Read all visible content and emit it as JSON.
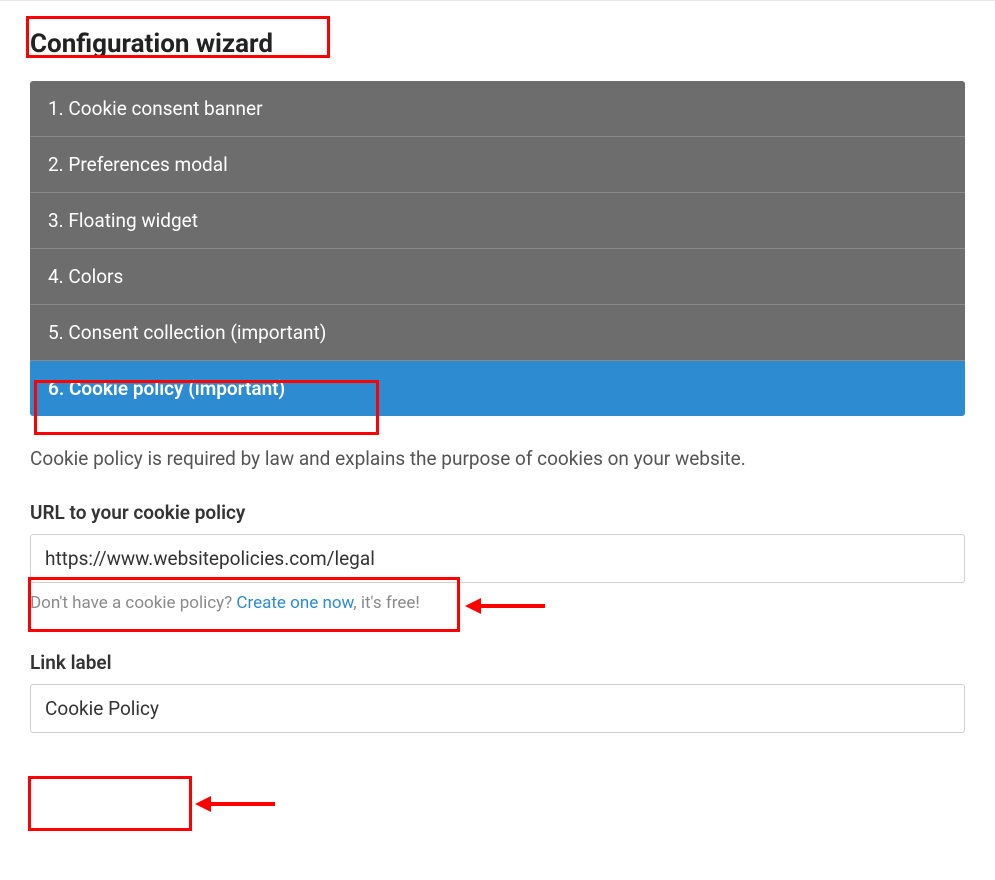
{
  "title": "Configuration wizard",
  "steps": [
    "1. Cookie consent banner",
    "2. Preferences modal",
    "3. Floating widget",
    "4. Colors",
    "5. Consent collection (important)",
    "6. Cookie policy (important)"
  ],
  "panel": {
    "description": "Cookie policy is required by law and explains the purpose of cookies on your website.",
    "url_label": "URL to your cookie policy",
    "url_value": "https://www.websitepolicies.com/legal",
    "hint_prefix": "Don't have a cookie policy? ",
    "hint_link": "Create one now",
    "hint_suffix": ", it's free!",
    "link_label_heading": "Link label",
    "link_label_value": "Cookie Policy"
  }
}
